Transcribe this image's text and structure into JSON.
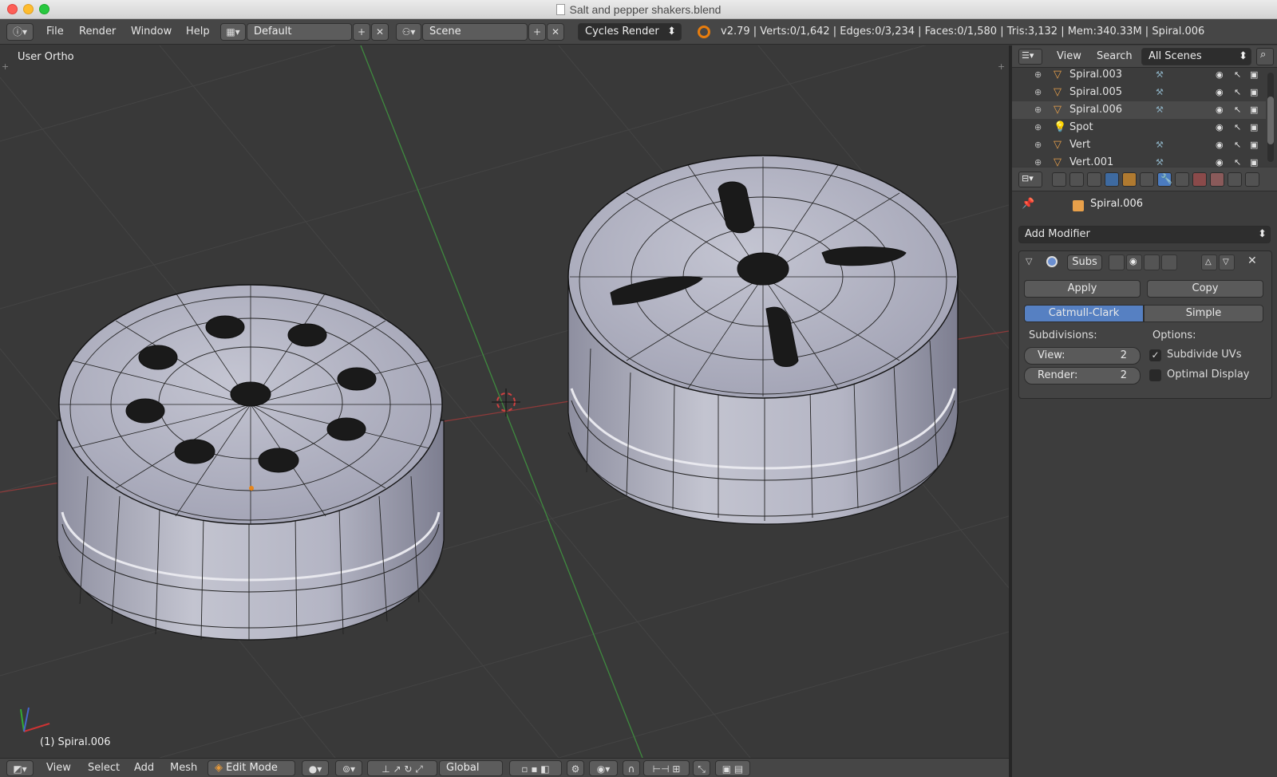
{
  "window": {
    "title": "Salt and pepper shakers.blend"
  },
  "info_header": {
    "menus": [
      "File",
      "Render",
      "Window",
      "Help"
    ],
    "screen_layout": "Default",
    "scene": "Scene",
    "render_engine": "Cycles Render",
    "stats": "v2.79 | Verts:0/1,642 | Edges:0/3,234 | Faces:0/1,580 | Tris:3,132 | Mem:340.33M | Spiral.006"
  },
  "viewport": {
    "view_label": "User Ortho",
    "object_label": "(1) Spiral.006"
  },
  "viewport_footer": {
    "menus": [
      "View",
      "Select",
      "Add",
      "Mesh"
    ],
    "mode": "Edit Mode",
    "orientation": "Global"
  },
  "outliner": {
    "menus": [
      "View",
      "Search"
    ],
    "filter": "All Scenes",
    "items": [
      {
        "name": "Spiral.003",
        "icon": "mesh-icon"
      },
      {
        "name": "Spiral.005",
        "icon": "mesh-icon"
      },
      {
        "name": "Spiral.006",
        "icon": "mesh-icon"
      },
      {
        "name": "Spot",
        "icon": "lamp-icon"
      },
      {
        "name": "Vert",
        "icon": "mesh-icon"
      },
      {
        "name": "Vert.001",
        "icon": "mesh-icon"
      }
    ]
  },
  "properties": {
    "context_object": "Spiral.006",
    "add_modifier": "Add Modifier",
    "modifier": {
      "name": "Subs",
      "apply": "Apply",
      "copy": "Copy",
      "types": [
        "Catmull-Clark",
        "Simple"
      ],
      "active_type": "Catmull-Clark",
      "subdivisions_label": "Subdivisions:",
      "options_label": "Options:",
      "view_label": "View:",
      "view_value": "2",
      "render_label": "Render:",
      "render_value": "2",
      "subdivide_uvs_label": "Subdivide UVs",
      "subdivide_uvs": true,
      "optimal_display_label": "Optimal Display",
      "optimal_display": false
    }
  },
  "colors": {
    "accent": "#5680c2",
    "mesh": "#b3b4c2",
    "grid_bg": "#393939"
  }
}
